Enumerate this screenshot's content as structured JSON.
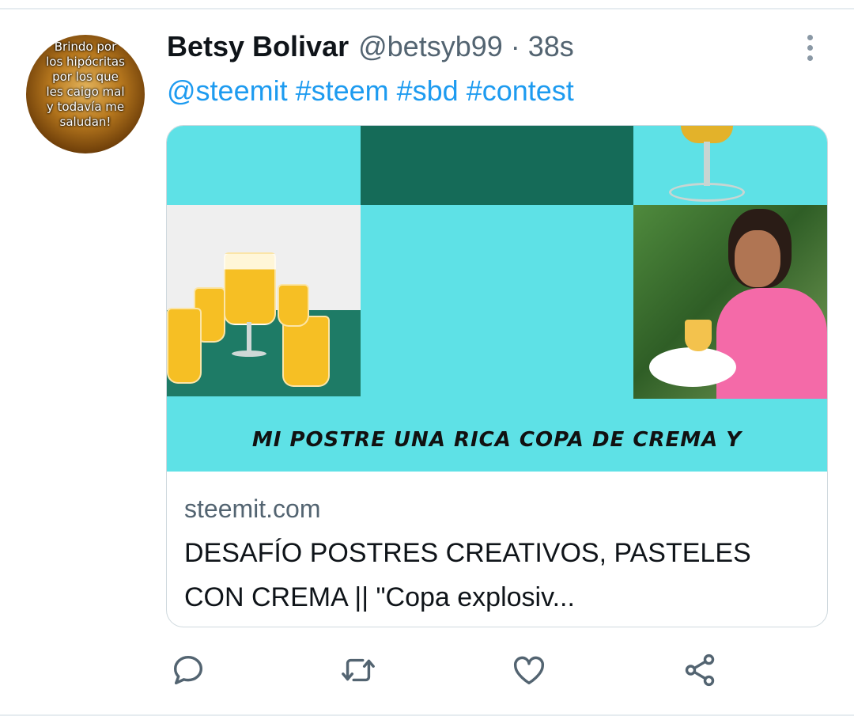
{
  "tweet": {
    "display_name": "Betsy Bolivar",
    "handle": "@betsyb99",
    "separator": "·",
    "timestamp": "38s",
    "avatar_text": "Brindo por\nlos hipócritas\npor los que\nles caigo mal\ny todavía me\nsaludan!",
    "hashtags": [
      "@steemit",
      "#steem",
      "#sbd",
      "#contest"
    ]
  },
  "card": {
    "image_caption": "MI POSTRE  UNA RICA COPA DE CREMA Y",
    "domain": "steemit.com",
    "title": "DESAFÍO POSTRES CREATIVOS, PASTELES CON CREMA || \"Copa explosiv..."
  },
  "actions": [
    {
      "name": "reply-icon"
    },
    {
      "name": "retweet-icon"
    },
    {
      "name": "like-icon"
    },
    {
      "name": "share-icon"
    }
  ],
  "colors": {
    "link": "#1d9bf0",
    "secondary_text": "#536471",
    "icon": "#536471",
    "card_background": "#5ee1e6"
  }
}
